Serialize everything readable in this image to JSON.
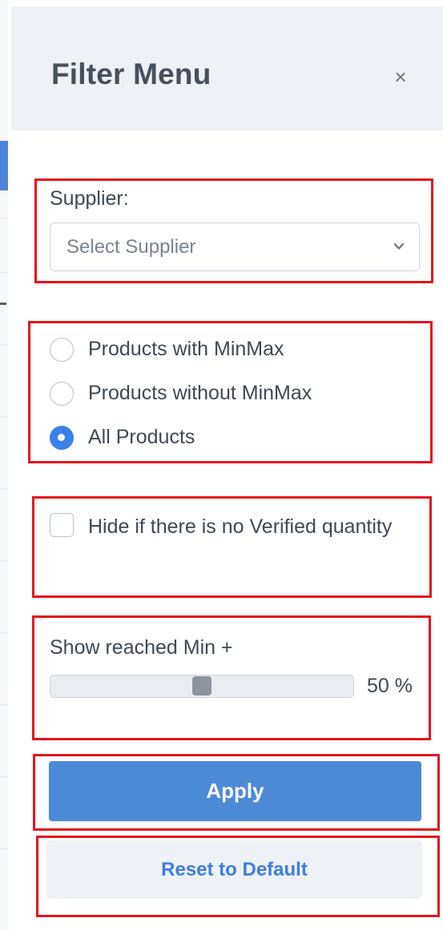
{
  "header": {
    "title": "Filter Menu",
    "close_icon": "×"
  },
  "supplier": {
    "label": "Supplier:",
    "placeholder": "Select Supplier"
  },
  "product_filter": {
    "options": [
      {
        "label": "Products with MinMax",
        "checked": false
      },
      {
        "label": "Products without MinMax",
        "checked": false
      },
      {
        "label": "All Products",
        "checked": true
      }
    ]
  },
  "verified_filter": {
    "label": "Hide if there is no Verified quantity",
    "checked": false
  },
  "min_threshold": {
    "label": "Show reached Min +",
    "value_percent": 50,
    "value_text": "50 %"
  },
  "actions": {
    "apply_label": "Apply",
    "reset_label": "Reset to Default"
  },
  "colors": {
    "accent": "#4d8ad6",
    "highlight_border": "#e4141e",
    "radio_checked": "#3b82e8"
  }
}
